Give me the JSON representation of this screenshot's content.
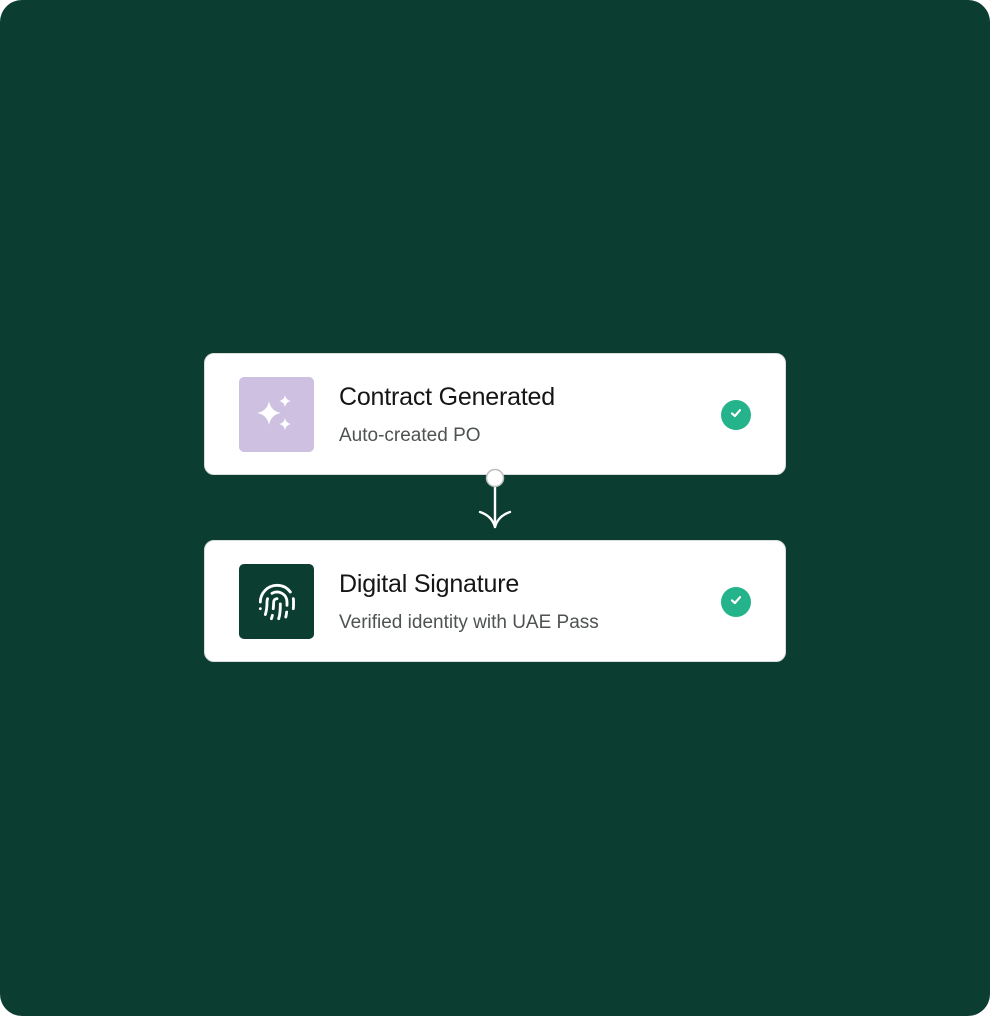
{
  "steps": [
    {
      "title": "Contract Generated",
      "subtitle": "Auto-created PO",
      "icon": "sparkles-icon",
      "status": "completed"
    },
    {
      "title": "Digital Signature",
      "subtitle": "Verified identity with UAE Pass",
      "icon": "fingerprint-icon",
      "status": "completed"
    }
  ],
  "colors": {
    "background": "#0b3d31",
    "card": "#ffffff",
    "sparkle_tile": "#cdc0e1",
    "fingerprint_tile": "#0b3d31",
    "check": "#24b38a"
  }
}
